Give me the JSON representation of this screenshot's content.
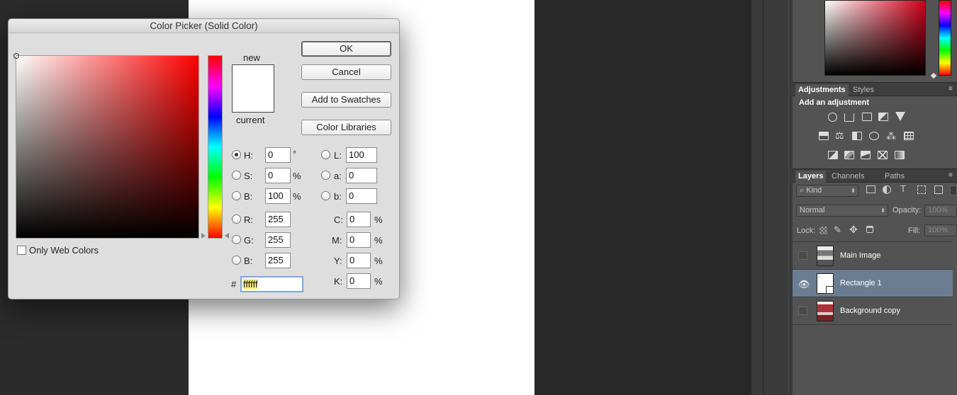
{
  "dialog": {
    "title": "Color Picker (Solid Color)",
    "new_label": "new",
    "current_label": "current",
    "new_color": "#ffffff",
    "buttons": {
      "ok": "OK",
      "cancel": "Cancel",
      "add_swatches": "Add to Swatches",
      "libraries": "Color Libraries"
    },
    "only_web_colors": "Only Web Colors",
    "hsb": [
      {
        "label": "H:",
        "value": "0",
        "unit": "°",
        "selected": true
      },
      {
        "label": "S:",
        "value": "0",
        "unit": "%"
      },
      {
        "label": "B:",
        "value": "100",
        "unit": "%"
      }
    ],
    "rgb": [
      {
        "label": "R:",
        "value": "255"
      },
      {
        "label": "G:",
        "value": "255"
      },
      {
        "label": "B:",
        "value": "255"
      }
    ],
    "lab": [
      {
        "label": "L:",
        "value": "100"
      },
      {
        "label": "a:",
        "value": "0"
      },
      {
        "label": "b:",
        "value": "0"
      }
    ],
    "cmyk": [
      {
        "label": "C:",
        "value": "0",
        "unit": "%"
      },
      {
        "label": "M:",
        "value": "0",
        "unit": "%"
      },
      {
        "label": "Y:",
        "value": "0",
        "unit": "%"
      },
      {
        "label": "K:",
        "value": "0",
        "unit": "%"
      }
    ],
    "hex_prefix": "#",
    "hex_value": "ffffff"
  },
  "panels": {
    "adjustments": {
      "tabs": [
        "Adjustments",
        "Styles"
      ],
      "heading": "Add an adjustment",
      "icons": [
        "brightness-icon",
        "levels-icon",
        "curves-icon",
        "exposure-icon",
        "vibrance-icon",
        "hue-saturation-icon",
        "color-balance-icon",
        "black-white-icon",
        "photo-filter-icon",
        "channel-mixer-icon",
        "color-lookup-icon",
        "invert-icon",
        "posterize-icon",
        "threshold-icon",
        "selective-color-icon",
        "gradient-map-icon"
      ]
    },
    "layers": {
      "tabs": [
        "Layers",
        "Channels",
        "Paths"
      ],
      "filter_kind": "Kind",
      "blend_mode": "Normal",
      "opacity_label": "Opacity:",
      "opacity_value": "100%",
      "lock_label": "Lock:",
      "fill_label": "Fill:",
      "fill_value": "100%",
      "items": [
        {
          "name": "Main Image",
          "visible": false,
          "selected": false
        },
        {
          "name": "Rectangle 1",
          "visible": true,
          "selected": true
        },
        {
          "name": "Background copy",
          "visible": false,
          "selected": false
        }
      ]
    }
  }
}
